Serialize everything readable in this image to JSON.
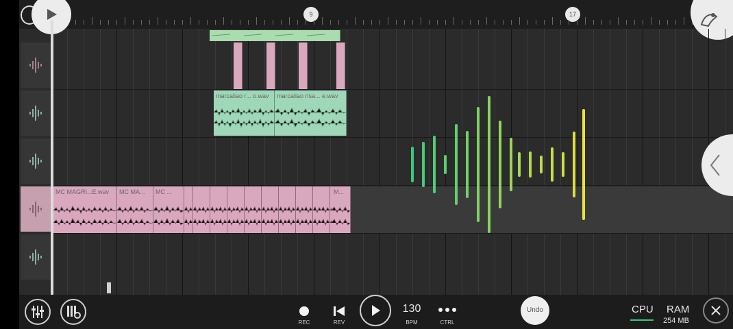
{
  "ruler": {
    "markers": [
      "9",
      "17"
    ]
  },
  "tracks": [
    {
      "name": "track-1"
    },
    {
      "name": "track-2"
    },
    {
      "name": "track-3"
    },
    {
      "name": "track-4"
    },
    {
      "name": "track-5"
    }
  ],
  "clips": {
    "green_a": "marcaliao r... o.wav",
    "green_b": "marcaliao risa... e.wav",
    "pink_a": "MC MAGRI...E.wav",
    "pink_b": "MC MA...",
    "pink_c": "MC ...",
    "pink_d": "M..."
  },
  "transport": {
    "rec_label": "REC",
    "rev_label": "REV",
    "bpm_value": "130",
    "bpm_label": "BPM",
    "ctrl_label": "CTRL",
    "undo_label": "Undo",
    "cpu_label": "CPU",
    "ram_label": "RAM",
    "ram_value": "254 MB"
  },
  "colors": {
    "green_clip": "#9fd8b8",
    "pink_clip": "#d9a8bf",
    "accent": "#3bc97c",
    "wave_top": "#e8e23a"
  },
  "icons": [
    "play-icon",
    "mixer-icon",
    "piano-settings-icon",
    "rewind-icon",
    "more-icon",
    "close-icon",
    "chevron-left-icon",
    "fl-logo-icon",
    "waveform-icon"
  ]
}
